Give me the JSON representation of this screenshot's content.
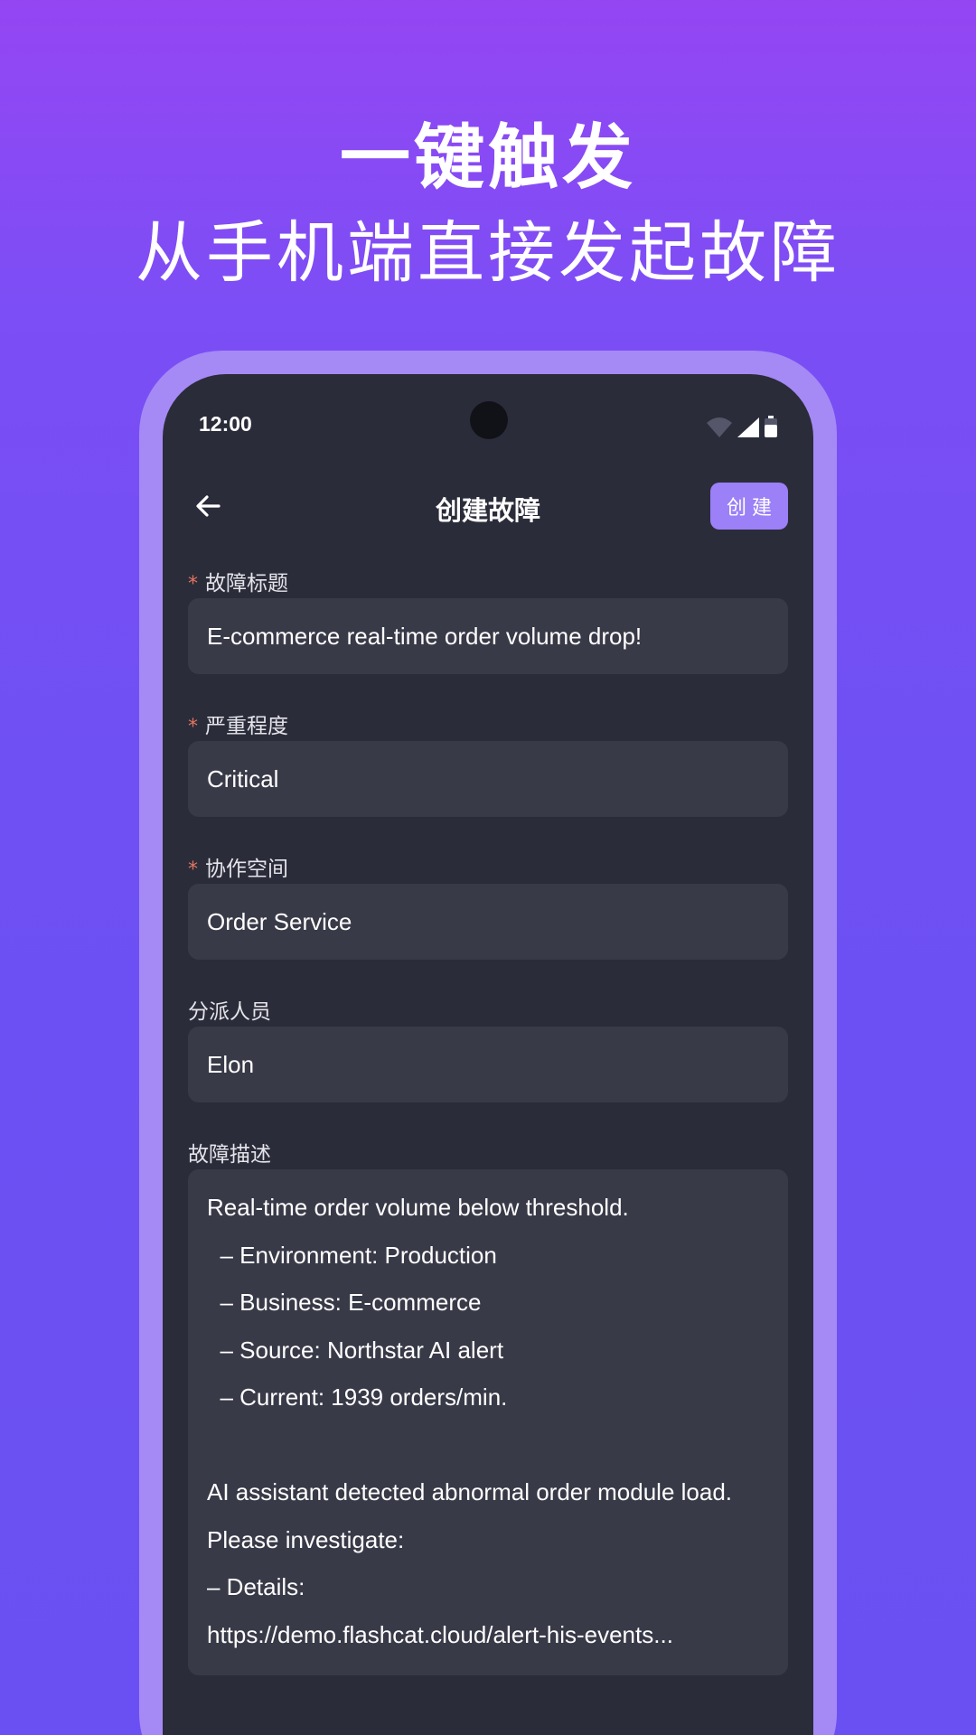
{
  "hero": {
    "title": "一键触发",
    "subtitle": "从手机端直接发起故障"
  },
  "status_bar": {
    "time": "12:00",
    "icons": [
      "wifi-icon",
      "signal-icon",
      "battery-icon"
    ]
  },
  "app_bar": {
    "title": "创建故障",
    "create_label": "创建"
  },
  "form": {
    "required_mark": "*",
    "title": {
      "label": "故障标题",
      "value": "E-commerce real-time order volume drop!"
    },
    "severity": {
      "label": "严重程度",
      "value": "Critical"
    },
    "workspace": {
      "label": "协作空间",
      "value": "Order Service"
    },
    "assignee": {
      "label": "分派人员",
      "value": "Elon"
    },
    "description": {
      "label": "故障描述",
      "value": "Real-time order volume below threshold.\n  – Environment: Production\n  – Business: E-commerce\n  – Source: Northstar AI alert\n  – Current: 1939 orders/min.\n\nAI assistant detected abnormal order module load. Please investigate:\n– Details:\nhttps://demo.flashcat.cloud/alert-his-events..."
    }
  },
  "colors": {
    "background_top": "#9446f3",
    "background_bottom": "#6a50f2",
    "phone_frame": "#a58af6",
    "screen_bg": "#2b2c3a",
    "input_bg": "#393a48",
    "accent_button": "#9b80f7",
    "required_mark": "#e2745f"
  }
}
